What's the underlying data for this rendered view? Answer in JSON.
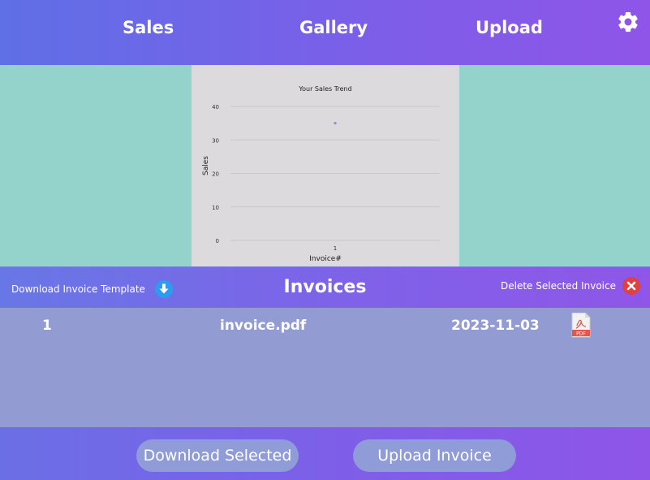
{
  "nav": {
    "tabs": [
      {
        "label": "Sales"
      },
      {
        "label": "Gallery"
      },
      {
        "label": "Upload"
      }
    ],
    "settings_icon": "gear-icon"
  },
  "chart_data": {
    "type": "scatter",
    "title": "Your Sales Trend",
    "xlabel": "Invoice#",
    "ylabel": "Sales",
    "x_ticks": [
      "1"
    ],
    "y_ticks": [
      "0",
      "10",
      "20",
      "30",
      "40"
    ],
    "ylim": [
      0,
      40
    ],
    "series": [
      {
        "x": [
          1
        ],
        "y": [
          35
        ]
      }
    ],
    "grid": true,
    "point_color": "#8a8ce0"
  },
  "invoices": {
    "title": "Invoices",
    "download_template_label": "Download Invoice Template",
    "delete_selected_label": "Delete Selected Invoice",
    "download_icon": "download-arrow-icon",
    "delete_icon": "close-circle-icon",
    "rows": [
      {
        "id": "1",
        "filename": "invoice.pdf",
        "date": "2023-11-03",
        "file_icon": "pdf-file-icon",
        "icon_text": "PDF"
      }
    ]
  },
  "footer": {
    "download_selected_label": "Download Selected",
    "upload_invoice_label": "Upload Invoice"
  },
  "colors": {
    "accent_blue": "#2d9cf0",
    "delete_red": "#e2403f",
    "pdf_red": "#e2574c"
  }
}
